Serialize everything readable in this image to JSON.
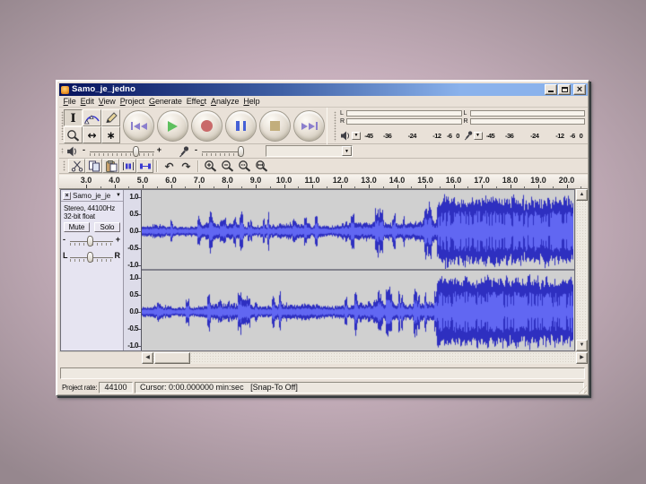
{
  "window": {
    "title": "Samo_je_jedno",
    "title_gradient": [
      "#06125c",
      "#3f60a5",
      "#8ab2ec"
    ]
  },
  "icons": {
    "close_x": "×",
    "dropdown": "▼",
    "up": "▲",
    "down": "▼",
    "left": "◀",
    "right": "▶",
    "undo": "↶",
    "redo": "↷",
    "timeshift": "↔",
    "multi": "∗",
    "selection": "I"
  },
  "menu": {
    "items": [
      {
        "label": "File",
        "u": 0
      },
      {
        "label": "Edit",
        "u": 0
      },
      {
        "label": "View",
        "u": 0
      },
      {
        "label": "Project",
        "u": 0
      },
      {
        "label": "Generate",
        "u": 0
      },
      {
        "label": "Effect",
        "u": 4
      },
      {
        "label": "Analyze",
        "u": 0
      },
      {
        "label": "Help",
        "u": 0
      }
    ]
  },
  "tools": {
    "items": [
      "selection",
      "envelope",
      "draw",
      "zoom",
      "timeshift",
      "multi"
    ]
  },
  "transport": {
    "buttons": [
      "rewind",
      "play",
      "record",
      "pause",
      "stop",
      "forward"
    ],
    "colors": {
      "rewind": "#8b7fcd",
      "play": "#5ec05e",
      "record": "#c96a6a",
      "pause": "#4661d6",
      "stop": "#c2ae7c",
      "forward": "#8b7fcd"
    }
  },
  "meters": [
    {
      "name": "playback",
      "icon": "speaker",
      "channels": [
        "L",
        "R"
      ],
      "scale": [
        "-45",
        "-36",
        "-24",
        "-12",
        "-6",
        "0"
      ]
    },
    {
      "name": "recording",
      "icon": "mic",
      "channels": [
        "L",
        "R"
      ],
      "scale": [
        "-45",
        "-36",
        "-24",
        "-12",
        "-6",
        "0"
      ]
    }
  ],
  "mixer": {
    "output_slider": {
      "min_label": "-",
      "max_label": "+"
    },
    "input_slider": {
      "min_label": "-",
      "max_label": "+"
    },
    "input_source_value": ""
  },
  "edit_toolbar": {
    "items": [
      "cut",
      "copy",
      "paste",
      "trim",
      "silence",
      "undo",
      "redo",
      "zoom-in",
      "zoom-out",
      "fit-selection",
      "fit-project"
    ],
    "groups": [
      5,
      2,
      4
    ]
  },
  "ruler": {
    "labels": [
      "3.0",
      "4.0",
      "5.0",
      "6.0",
      "7.0",
      "8.0",
      "9.0",
      "10.0",
      "11.0",
      "12.0",
      "13.0",
      "14.0",
      "15.0",
      "16.0",
      "17.0",
      "18.0",
      "19.0",
      "20.0"
    ]
  },
  "track": {
    "title": "Samo_je_je",
    "info1": "Stereo, 44100Hz",
    "info2": "32-bit float",
    "mute_label": "Mute",
    "solo_label": "Solo",
    "gain": {
      "min_label": "-",
      "max_label": "+"
    },
    "pan": {
      "min_label": "L",
      "max_label": "R"
    },
    "scale": [
      "1.0",
      "0.5",
      "0.0",
      "-0.5",
      "-1.0"
    ],
    "waveform": {
      "bg": "#d0d0d0",
      "color_dark": "#2e2fc0",
      "color_light": "#6167f2",
      "loud_start": 0.683,
      "channel_seeds": [
        7,
        13
      ]
    }
  },
  "status": {
    "rate_label": "Project rate:",
    "rate_value": "44100",
    "cursor": "Cursor: 0:00.000000 min:sec   [Snap-To Off]"
  }
}
